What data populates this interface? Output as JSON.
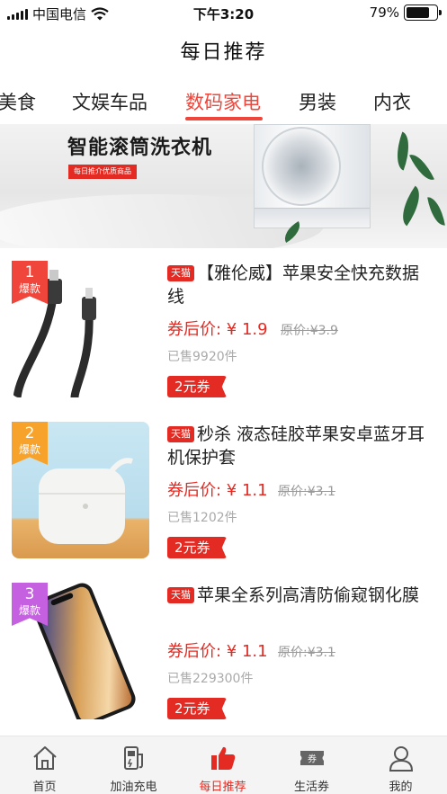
{
  "status_bar": {
    "carrier": "中国电信",
    "time": "下午3:20",
    "battery": "79%",
    "battery_level": 0.79
  },
  "header": {
    "title": "每日推荐"
  },
  "tabs": [
    {
      "label": "美食"
    },
    {
      "label": "文娱车品"
    },
    {
      "label": "数码家电",
      "active": true
    },
    {
      "label": "男装"
    },
    {
      "label": "内衣"
    }
  ],
  "banner": {
    "title": "智能滚筒洗衣机",
    "tag": "每日推介优质商品"
  },
  "products": [
    {
      "rank": "1",
      "rank_tag": "爆款",
      "platform": "天猫",
      "title": "【雅伦威】苹果安全快充数据线",
      "price": "券后价: ¥ 1.9",
      "original": "原价:¥3.9",
      "sold": "已售9920件",
      "coupon": "2元券",
      "rank_color": "#f0453a"
    },
    {
      "rank": "2",
      "rank_tag": "爆款",
      "platform": "天猫",
      "title": "秒杀 液态硅胶苹果安卓蓝牙耳机保护套",
      "price": "券后价: ¥ 1.1",
      "original": "原价:¥3.1",
      "sold": "已售1202件",
      "coupon": "2元券",
      "rank_color": "#f7a22b"
    },
    {
      "rank": "3",
      "rank_tag": "爆款",
      "platform": "天猫",
      "title": "苹果全系列高清防偷窥钢化膜",
      "price": "券后价: ¥ 1.1",
      "original": "原价:¥3.1",
      "sold": "已售229300件",
      "coupon": "2元券",
      "rank_color": "#c561e0"
    }
  ],
  "bottom_nav": [
    {
      "label": "首页",
      "icon": "home-icon"
    },
    {
      "label": "加油充电",
      "icon": "fuel-icon"
    },
    {
      "label": "每日推荐",
      "icon": "thumbs-up-icon",
      "active": true
    },
    {
      "label": "生活券",
      "icon": "ticket-icon"
    },
    {
      "label": "我的",
      "icon": "user-icon"
    }
  ],
  "colors": {
    "accent": "#e32b23",
    "tab_active": "#f0453a"
  }
}
